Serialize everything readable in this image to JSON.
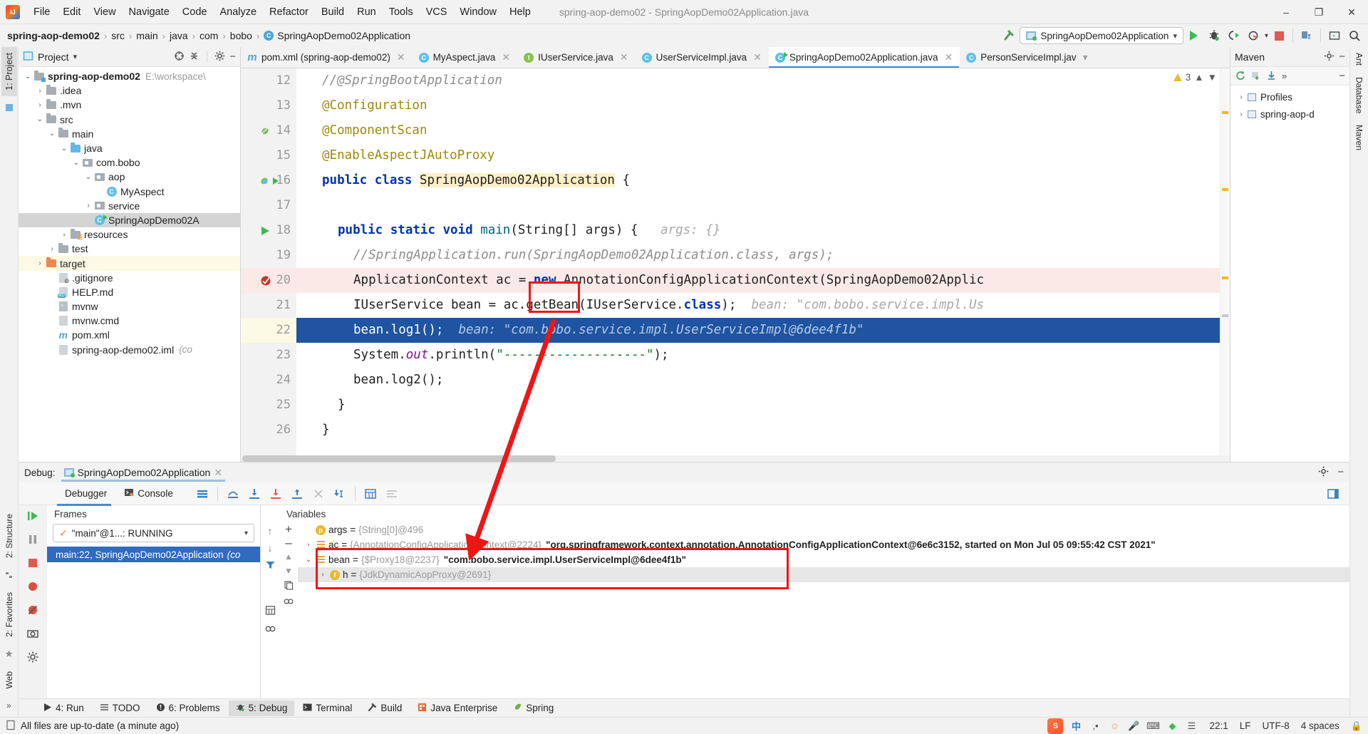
{
  "window": {
    "title": "spring-aop-demo02 - SpringAopDemo02Application.java",
    "minimize": "–",
    "maximize": "❐",
    "close": "✕"
  },
  "menu": {
    "items": [
      "File",
      "Edit",
      "View",
      "Navigate",
      "Code",
      "Analyze",
      "Refactor",
      "Build",
      "Run",
      "Tools",
      "VCS",
      "Window",
      "Help"
    ]
  },
  "breadcrumb": {
    "root": "spring-aop-demo02",
    "items": [
      "src",
      "main",
      "java",
      "com",
      "bobo"
    ],
    "file": "SpringAopDemo02Application",
    "file_icon": "class-icon"
  },
  "toolbar": {
    "run_config": "SpringAopDemo02Application",
    "dropdown_caret": "▾",
    "run_label": "run-icon",
    "debug_label": "debug-icon",
    "run_coverage_label": "run-with-coverage-icon",
    "profiler_label": "profiler-icon",
    "stop_label": "stop-icon",
    "updates_label": "updates-icon",
    "terminal_label": "terminal-icon",
    "search_label": "search-everywhere-icon"
  },
  "left_strip": {
    "project_tab": "1: Project",
    "structure_tab": "2: Structure",
    "favorites_tab": "2: Favorites",
    "web_tab": "Web",
    "more": "»"
  },
  "right_strip": {
    "ant_tab": "Ant",
    "database_tab": "Database",
    "maven_tab": "Maven"
  },
  "project_panel": {
    "title": "Project",
    "caret": "▾",
    "icons": [
      "target-icon",
      "collapse-all-icon",
      "settings-icon",
      "hide-icon"
    ],
    "tree": [
      {
        "depth": 0,
        "twisty": "⌄",
        "icon": "module-folder",
        "label": "spring-aop-demo02",
        "bold": true,
        "path": "E:\\workspace\\",
        "state": "normal"
      },
      {
        "depth": 1,
        "twisty": "›",
        "icon": "folder",
        "label": ".idea",
        "state": "normal"
      },
      {
        "depth": 1,
        "twisty": "›",
        "icon": "folder",
        "label": ".mvn",
        "state": "normal"
      },
      {
        "depth": 1,
        "twisty": "⌄",
        "icon": "folder",
        "label": "src",
        "state": "normal"
      },
      {
        "depth": 2,
        "twisty": "⌄",
        "icon": "folder",
        "label": "main",
        "state": "normal"
      },
      {
        "depth": 3,
        "twisty": "⌄",
        "icon": "folder-blue",
        "label": "java",
        "state": "normal"
      },
      {
        "depth": 4,
        "twisty": "⌄",
        "icon": "package",
        "label": "com.bobo",
        "state": "normal"
      },
      {
        "depth": 5,
        "twisty": "⌄",
        "icon": "package",
        "label": "aop",
        "state": "normal"
      },
      {
        "depth": 6,
        "twisty": "",
        "icon": "class",
        "label": "MyAspect",
        "state": "normal"
      },
      {
        "depth": 5,
        "twisty": "›",
        "icon": "package",
        "label": "service",
        "state": "normal"
      },
      {
        "depth": 5,
        "twisty": "",
        "icon": "class-runnable",
        "label": "SpringAopDemo02A",
        "state": "selected"
      },
      {
        "depth": 3,
        "twisty": "›",
        "icon": "folder-resources",
        "label": "resources",
        "state": "normal"
      },
      {
        "depth": 2,
        "twisty": "›",
        "icon": "folder",
        "label": "test",
        "state": "normal"
      },
      {
        "depth": 1,
        "twisty": "›",
        "icon": "folder-orange",
        "label": "target",
        "state": "highlight"
      },
      {
        "depth": 2,
        "twisty": "",
        "icon": "file-git",
        "label": ".gitignore",
        "state": "normal"
      },
      {
        "depth": 2,
        "twisty": "",
        "icon": "file-md",
        "label": "HELP.md",
        "state": "normal"
      },
      {
        "depth": 2,
        "twisty": "",
        "icon": "file-sh",
        "label": "mvnw",
        "state": "normal"
      },
      {
        "depth": 2,
        "twisty": "",
        "icon": "file",
        "label": "mvnw.cmd",
        "state": "normal"
      },
      {
        "depth": 2,
        "twisty": "",
        "icon": "file-maven",
        "label": "pom.xml",
        "state": "normal"
      },
      {
        "depth": 2,
        "twisty": "",
        "icon": "file",
        "label": "spring-aop-demo02.iml",
        "italic_tail": "(co",
        "state": "normal"
      }
    ]
  },
  "editor_tabs": [
    {
      "label": "pom.xml (spring-aop-demo02)",
      "icon": "maven-icon",
      "active": false,
      "closable": true
    },
    {
      "label": "MyAspect.java",
      "icon": "class-icon",
      "active": false,
      "closable": true
    },
    {
      "label": "IUserService.java",
      "icon": "interface-icon",
      "active": false,
      "closable": true
    },
    {
      "label": "UserServiceImpl.java",
      "icon": "class-icon",
      "active": false,
      "closable": true
    },
    {
      "label": "SpringAopDemo02Application.java",
      "icon": "class-runnable-icon",
      "active": true,
      "closable": true
    },
    {
      "label": "PersonServiceImpl.jav",
      "icon": "class-icon",
      "active": false,
      "closable": false
    }
  ],
  "editor": {
    "inspection_count": "3",
    "lines": [
      {
        "n": "12",
        "text": "//@SpringBootApplication",
        "kind": "comment",
        "indent": 1,
        "clipped": true
      },
      {
        "n": "13",
        "text": "@Configuration",
        "kind": "annotation",
        "indent": 1,
        "fold": "▽"
      },
      {
        "n": "14",
        "text": "@ComponentScan",
        "kind": "annotation",
        "indent": 1,
        "gutter": "bean-icon"
      },
      {
        "n": "15",
        "text": "@EnableAspectJAutoProxy",
        "kind": "annotation",
        "indent": 1,
        "fold": "⌂"
      },
      {
        "n": "16",
        "text": "public class SpringAopDemo02Application {",
        "kind": "class-decl",
        "indent": 1,
        "gutter": "spring-bean-run"
      },
      {
        "n": "17",
        "text": "",
        "kind": "blank",
        "indent": 0
      },
      {
        "n": "18",
        "text": "public static void main(String[] args) {",
        "kind": "method-decl",
        "indent": 2,
        "hint": "args: {}",
        "gutter": "run-icon",
        "fold": "▽"
      },
      {
        "n": "19",
        "text": "//SpringApplication.run(SpringAopDemo02Application.class, args);",
        "kind": "comment",
        "indent": 3
      },
      {
        "n": "20",
        "text": "ApplicationContext ac = new AnnotationConfigApplicationContext(SpringAopDemo02Applic",
        "kind": "stmt-new",
        "indent": 3,
        "exec": true,
        "gutter": "breakpoint-done"
      },
      {
        "n": "21",
        "text": "IUserService bean = ac.getBean(IUserService.class);",
        "kind": "stmt-getbean",
        "indent": 3,
        "hint": "bean: \"com.bobo.service.impl.Us"
      },
      {
        "n": "22",
        "text": "bean.log1();",
        "kind": "stmt-plain",
        "indent": 3,
        "selected": true,
        "hint": "bean: \"com.bobo.service.impl.UserServiceImpl@6dee4f1b\""
      },
      {
        "n": "23",
        "text": "System.out.println(\"-------------------\");",
        "kind": "stmt-println",
        "indent": 3
      },
      {
        "n": "24",
        "text": "bean.log2();",
        "kind": "stmt-plain",
        "indent": 3
      },
      {
        "n": "25",
        "text": "}",
        "kind": "brace",
        "indent": 2,
        "fold": "⌂"
      },
      {
        "n": "26",
        "text": "}",
        "kind": "brace",
        "indent": 1
      }
    ]
  },
  "maven_panel": {
    "title": "Maven",
    "settings_icon": "gear-icon",
    "toolbar_icons": [
      "refresh-icon",
      "add-icon",
      "download-icon",
      "more-icon"
    ],
    "rows": [
      {
        "depth": 0,
        "twisty": "›",
        "label": "Profiles",
        "icon": "profiles-icon"
      },
      {
        "depth": 0,
        "twisty": "›",
        "label": "spring-aop-d",
        "icon": "maven-module-icon"
      }
    ]
  },
  "debug": {
    "label": "Debug:",
    "session": "SpringAopDemo02Application",
    "close": "✕",
    "settings_icon": "gear-icon",
    "hide_icon": "hide-icon",
    "layout_icon": "layout-icon",
    "tabs": [
      {
        "label": "Debugger",
        "icon": "debugger-icon",
        "active": true
      },
      {
        "label": "Console",
        "icon": "console-icon",
        "active": false
      }
    ],
    "toolbar_icons": [
      "mute-breakpoints-icon",
      "step-over-icon",
      "step-into-icon",
      "force-step-into-icon",
      "step-out-icon",
      "drop-frame-icon",
      "run-to-cursor-icon",
      "evaluate-icon",
      "settings-icon"
    ],
    "side_icons": [
      "resume-icon",
      "pause-icon",
      "stop-icon",
      "view-breakpoints-icon",
      "mute-breakpoints-icon",
      "camera-icon",
      "settings-icon"
    ],
    "frames": {
      "title": "Frames",
      "thread_selector": "\"main\"@1...: RUNNING",
      "thread_caret": "▾",
      "up_icon": "arrow-up-icon",
      "down_icon": "arrow-down-icon",
      "filter_icon": "filter-icon",
      "rows": [
        {
          "label": "main:22, SpringAopDemo02Application",
          "tail": "(co",
          "selected": true
        }
      ]
    },
    "variables": {
      "title": "Variables",
      "add_icon": "+",
      "remove_icon": "–",
      "rows": [
        {
          "twisty": "",
          "icon": "param",
          "name": "args",
          "eq": "=",
          "type": "{String[0]@496",
          "value": "",
          "depth": 1,
          "highlight": false
        },
        {
          "twisty": "›",
          "icon": "list",
          "name": "ac",
          "eq": "=",
          "type": "{AnnotationConfigApplicationContext@2224}",
          "value": "\"org.springframework.context.annotation.AnnotationConfigApplicationContext@6e6c3152, started on Mon Jul 05 09:55:42 CST 2021\"",
          "depth": 1,
          "highlight": false
        },
        {
          "twisty": "⌄",
          "icon": "list",
          "name": "bean",
          "eq": "=",
          "type": "{$Proxy18@2237}",
          "value": "\"com.bobo.service.impl.UserServiceImpl@6dee4f1b\"",
          "depth": 1,
          "highlight": false
        },
        {
          "twisty": "›",
          "icon": "field",
          "name": "h",
          "eq": "=",
          "type": "{JdkDynamicAopProxy@2691}",
          "value": "",
          "depth": 2,
          "highlight": true
        }
      ]
    }
  },
  "tool_windows": [
    {
      "label": "4: Run",
      "icon": "run-icon",
      "active": false
    },
    {
      "label": "TODO",
      "icon": "todo-icon",
      "active": false
    },
    {
      "label": "6: Problems",
      "icon": "problems-icon",
      "active": false
    },
    {
      "label": "5: Debug",
      "icon": "debug-icon",
      "active": true
    },
    {
      "label": "Terminal",
      "icon": "terminal-icon",
      "active": false
    },
    {
      "label": "Build",
      "icon": "build-icon",
      "active": false
    },
    {
      "label": "Java Enterprise",
      "icon": "java-enterprise-icon",
      "active": false
    },
    {
      "label": "Spring",
      "icon": "spring-icon",
      "active": false
    }
  ],
  "statusbar": {
    "message": "All files are up-to-date (a minute ago)",
    "message_icon": "document-icon",
    "caret_position": "22:1",
    "line_separator": "LF",
    "encoding": "UTF-8",
    "indent": "4 spaces",
    "lock_icon": "lock-icon",
    "tray": [
      "sogou-icon",
      "lang-cn",
      "half-width",
      "emoji-icon",
      "mic-icon",
      "keyboard-icon",
      "toolbox-icon",
      "menu-icon"
    ]
  },
  "colors": {
    "accent_blue": "#4a89d6",
    "selection_blue": "#1e54a0",
    "annotation_red": "#f01515",
    "warning_yellow": "#e8b931",
    "green": "#3cba54",
    "exec_line": "#fbe9e7"
  }
}
